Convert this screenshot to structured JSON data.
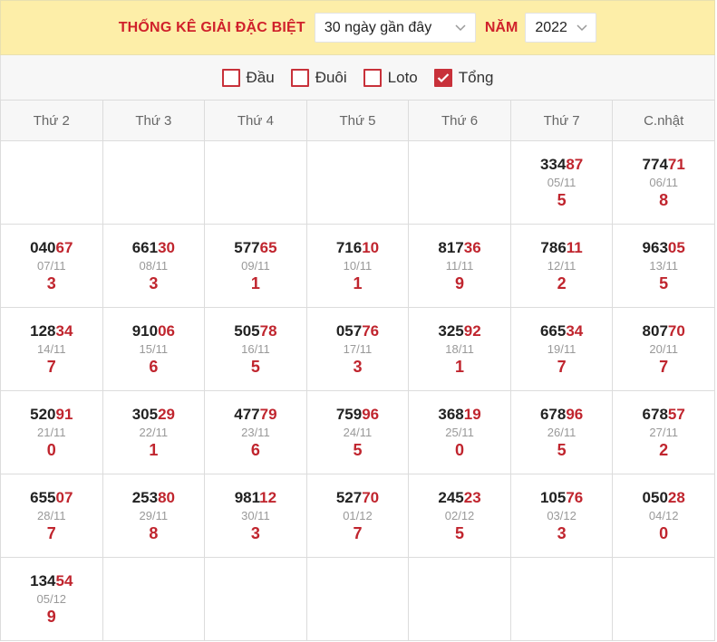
{
  "header": {
    "title": "THỐNG KÊ GIẢI ĐẶC BIỆT",
    "range_select": "30 ngày gần đây",
    "year_label": "NĂM",
    "year_select": "2022"
  },
  "filters": [
    {
      "label": "Đầu",
      "checked": false
    },
    {
      "label": "Đuôi",
      "checked": false
    },
    {
      "label": "Loto",
      "checked": false
    },
    {
      "label": "Tổng",
      "checked": true
    }
  ],
  "columns": [
    "Thứ 2",
    "Thứ 3",
    "Thứ 4",
    "Thứ 5",
    "Thứ 6",
    "Thứ 7",
    "C.nhật"
  ],
  "rows": [
    [
      null,
      null,
      null,
      null,
      null,
      {
        "head": "334",
        "tail": "87",
        "date": "05/11",
        "sum": "5"
      },
      {
        "head": "774",
        "tail": "71",
        "date": "06/11",
        "sum": "8"
      }
    ],
    [
      {
        "head": "040",
        "tail": "67",
        "date": "07/11",
        "sum": "3"
      },
      {
        "head": "661",
        "tail": "30",
        "date": "08/11",
        "sum": "3"
      },
      {
        "head": "577",
        "tail": "65",
        "date": "09/11",
        "sum": "1"
      },
      {
        "head": "716",
        "tail": "10",
        "date": "10/11",
        "sum": "1"
      },
      {
        "head": "817",
        "tail": "36",
        "date": "11/11",
        "sum": "9"
      },
      {
        "head": "786",
        "tail": "11",
        "date": "12/11",
        "sum": "2"
      },
      {
        "head": "963",
        "tail": "05",
        "date": "13/11",
        "sum": "5"
      }
    ],
    [
      {
        "head": "128",
        "tail": "34",
        "date": "14/11",
        "sum": "7"
      },
      {
        "head": "910",
        "tail": "06",
        "date": "15/11",
        "sum": "6"
      },
      {
        "head": "505",
        "tail": "78",
        "date": "16/11",
        "sum": "5"
      },
      {
        "head": "057",
        "tail": "76",
        "date": "17/11",
        "sum": "3"
      },
      {
        "head": "325",
        "tail": "92",
        "date": "18/11",
        "sum": "1"
      },
      {
        "head": "665",
        "tail": "34",
        "date": "19/11",
        "sum": "7"
      },
      {
        "head": "807",
        "tail": "70",
        "date": "20/11",
        "sum": "7"
      }
    ],
    [
      {
        "head": "520",
        "tail": "91",
        "date": "21/11",
        "sum": "0"
      },
      {
        "head": "305",
        "tail": "29",
        "date": "22/11",
        "sum": "1"
      },
      {
        "head": "477",
        "tail": "79",
        "date": "23/11",
        "sum": "6"
      },
      {
        "head": "759",
        "tail": "96",
        "date": "24/11",
        "sum": "5"
      },
      {
        "head": "368",
        "tail": "19",
        "date": "25/11",
        "sum": "0"
      },
      {
        "head": "678",
        "tail": "96",
        "date": "26/11",
        "sum": "5"
      },
      {
        "head": "678",
        "tail": "57",
        "date": "27/11",
        "sum": "2"
      }
    ],
    [
      {
        "head": "655",
        "tail": "07",
        "date": "28/11",
        "sum": "7"
      },
      {
        "head": "253",
        "tail": "80",
        "date": "29/11",
        "sum": "8"
      },
      {
        "head": "981",
        "tail": "12",
        "date": "30/11",
        "sum": "3"
      },
      {
        "head": "527",
        "tail": "70",
        "date": "01/12",
        "sum": "7"
      },
      {
        "head": "245",
        "tail": "23",
        "date": "02/12",
        "sum": "5"
      },
      {
        "head": "105",
        "tail": "76",
        "date": "03/12",
        "sum": "3"
      },
      {
        "head": "050",
        "tail": "28",
        "date": "04/12",
        "sum": "0"
      }
    ],
    [
      {
        "head": "134",
        "tail": "54",
        "date": "05/12",
        "sum": "9"
      },
      null,
      null,
      null,
      null,
      null,
      null
    ]
  ]
}
